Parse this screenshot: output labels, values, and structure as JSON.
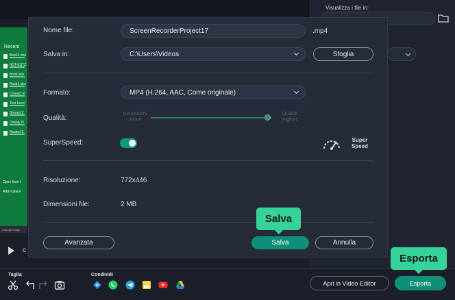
{
  "background": {
    "preview": {
      "recent_label": "Recent",
      "files": [
        "Book2.xlsx",
        "NST-ESTZ",
        "Book.xlsx",
        "Book1.xlsx",
        "Contact R",
        "Test Excel",
        "Shared Z",
        "Deeply N",
        "Nested S"
      ],
      "open_from": "Open from t",
      "add_place": "Add a place",
      "change": "Change Image"
    },
    "right_panel": {
      "visualizza_label": "Visualizza i file in:"
    }
  },
  "dialog": {
    "nome_file_label": "Nome file:",
    "nome_file_value": "ScreenRecorderProject17",
    "extension": ".mp4",
    "salva_in_label": "Salva in:",
    "salva_in_value": "C:\\Users\\Videos",
    "sfoglia_label": "Sfoglia",
    "formato_label": "Formato:",
    "formato_value": "MP4 (H.264, AAC, Come originale)",
    "qualita_label": "Qualità:",
    "qualita_min_label": "Dimensioni minori",
    "qualita_max_label": "Qualità migliore",
    "qualita_level": 0.97,
    "superspeed_label": "SuperSpeed:",
    "superspeed_on": true,
    "super_speed_badge": "Super Speed",
    "risoluzione_label": "Risoluzione:",
    "risoluzione_value": "772x446",
    "dimensioni_label": "Dimensioni file:",
    "dimensioni_value": "2 MB",
    "avanzata_label": "Avanzata",
    "salva_label": "Salva",
    "annulla_label": "Annulla"
  },
  "bottom_bar": {
    "taglia_label": "Taglia",
    "condividi_label": "Condividi",
    "video_editor_label": "Apri in Video Editor",
    "esporta_label": "Esporta"
  },
  "callouts": {
    "salva": "Salva",
    "esporta": "Esporta"
  },
  "colors": {
    "accent": "#0f8f77",
    "callout": "#35d399",
    "dialog_bg": "#262b38",
    "app_bg": "#1b1f29"
  }
}
